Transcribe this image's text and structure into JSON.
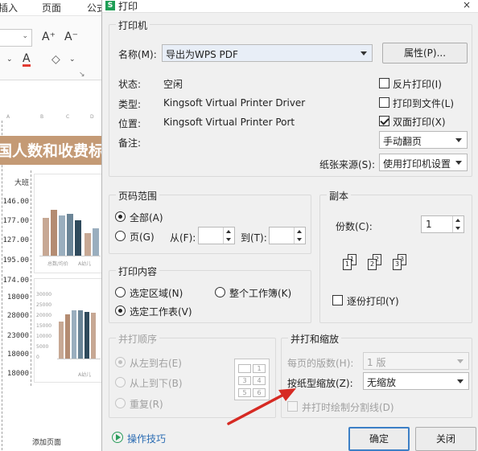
{
  "background": {
    "ribbon_tabs": [
      "插入",
      "页面",
      "公式"
    ],
    "ribbon_buttons": {
      "grow_font": "A⁺",
      "shrink_font": "A⁻",
      "font_color": "A",
      "eraser": "◇"
    },
    "sheet_title": "国人数和收费标",
    "column_header": "大班",
    "rows_upper": [
      "146.00",
      "177.00",
      "127.00",
      "195.00",
      "174.00"
    ],
    "rows_lower": [
      "18000",
      "28000",
      "23000",
      "18000",
      "18000"
    ],
    "chart1_axis_label": "总数/均价",
    "chart1_legend": "A幼儿",
    "chart2_axis_ticks": [
      "30000",
      "25000",
      "20000",
      "15000",
      "10000",
      "5000",
      "0"
    ],
    "chart2_legend": "A幼儿",
    "add_page": "添加页面"
  },
  "dialog": {
    "title": "打印",
    "app_icon": "S",
    "close": "×",
    "printer": {
      "group_title": "打印机",
      "name_label": "名称(M):",
      "name_value": "导出为WPS PDF",
      "properties_button": "属性(P)...",
      "status_label": "状态:",
      "status_value": "空闲",
      "type_label": "类型:",
      "type_value": "Kingsoft Virtual Printer Driver",
      "location_label": "位置:",
      "location_value": "Kingsoft Virtual Printer Port",
      "comment_label": "备注:",
      "reverse_print": {
        "label": "反片打印(I)",
        "checked": false
      },
      "print_to_file": {
        "label": "打印到文件(L)",
        "checked": false
      },
      "duplex": {
        "label": "双面打印(X)",
        "checked": true
      },
      "duplex_mode": "手动翻页",
      "paper_source_label": "纸张来源(S):",
      "paper_source_value": "使用打印机设置"
    },
    "page_range": {
      "group_title": "页码范围",
      "all_label": "全部(A)",
      "pages_label": "页(G)",
      "from_label": "从(F):",
      "to_label": "到(T):",
      "selected": "all"
    },
    "copies": {
      "group_title": "副本",
      "count_label": "份数(C):",
      "count_value": "1",
      "collate_label": "逐份打印(Y)",
      "collate_checked": false,
      "collate_icon_numbers": [
        "1",
        "1",
        "2",
        "2",
        "3",
        "3"
      ]
    },
    "print_content": {
      "group_title": "打印内容",
      "selection_label": "选定区域(N)",
      "workbook_label": "整个工作簿(K)",
      "sheet_label": "选定工作表(V)",
      "selected": "sheet"
    },
    "collate_order": {
      "group_title": "并打顺序",
      "left_to_right": "从左到右(E)",
      "top_to_bottom": "从上到下(B)",
      "repeat": "重复(R)",
      "order_cells": [
        "1",
        "2",
        "3",
        "4",
        "5",
        "6"
      ]
    },
    "scaling": {
      "group_title": "并打和缩放",
      "pages_per_sheet_label": "每页的版数(H):",
      "pages_per_sheet_value": "1 版",
      "scale_label": "按纸型缩放(Z):",
      "scale_value": "无缩放",
      "draw_divider_label": "并打时绘制分割线(D)"
    },
    "tips_link": "操作技巧",
    "ok_button": "确定",
    "cancel_button": "关闭"
  },
  "colors": {
    "accent": "#3c7fc6",
    "arrow": "#d62a23",
    "title_band": "#c49a75"
  }
}
